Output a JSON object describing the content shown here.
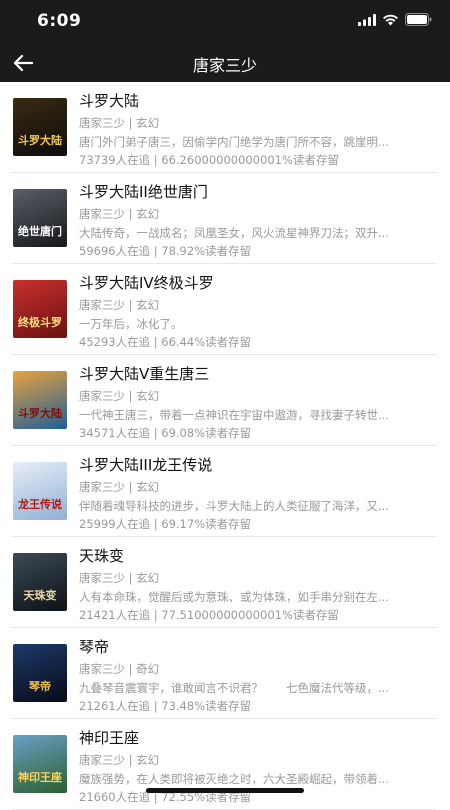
{
  "status": {
    "time": "6:09"
  },
  "header": {
    "title": "唐家三少"
  },
  "colors": {
    "header_bg": "#1b1b1b"
  },
  "books": [
    {
      "title": "斗罗大陆",
      "meta": "唐家三少 | 玄幻",
      "desc": "唐门外门弟子唐三，因偷学内门绝学为唐门所不容，跳崖明...",
      "stats": "73739人在追 | 66.26000000000001%读者存留",
      "cover_text": "斗罗大陆",
      "cover_colors": [
        "#3a2a12",
        "#0d0d0d"
      ],
      "cover_text_color": "#f2c94c"
    },
    {
      "title": "斗罗大陆II绝世唐门",
      "meta": "唐家三少 | 玄幻",
      "desc": "大陆传奇，一战成名；凤凰圣女，风火流星神界刀法；双升...",
      "stats": "59696人在追 | 78.92%读者存留",
      "cover_text": "绝世唐门",
      "cover_colors": [
        "#5b5f66",
        "#16181b"
      ],
      "cover_text_color": "#ffffff"
    },
    {
      "title": "斗罗大陆IV终极斗罗",
      "meta": "唐家三少 | 玄幻",
      "desc": "一万年后，冰化了。",
      "stats": "45293人在追 | 66.44%读者存留",
      "cover_text": "终极斗罗",
      "cover_colors": [
        "#c9302c",
        "#6a1212"
      ],
      "cover_text_color": "#ffe680"
    },
    {
      "title": "斗罗大陆V重生唐三",
      "meta": "唐家三少 | 玄幻",
      "desc": "一代神王唐三，带着一点神识在宇宙中遨游，寻找妻子转世...",
      "stats": "34571人在追 | 69.08%读者存留",
      "cover_text": "斗罗大陆",
      "cover_colors": [
        "#e9a23b",
        "#1f5f9a"
      ],
      "cover_text_color": "#7a1010"
    },
    {
      "title": "斗罗大陆III龙王传说",
      "meta": "唐家三少 | 玄幻",
      "desc": "伴随着魂导科技的进步，斗罗大陆上的人类征服了海洋，又...",
      "stats": "25999人在追 | 69.17%读者存留",
      "cover_text": "龙王传说",
      "cover_colors": [
        "#e8eef6",
        "#8fb0d6"
      ],
      "cover_text_color": "#b01818"
    },
    {
      "title": "天珠变",
      "meta": "唐家三少 | 玄幻",
      "desc": "人有本命珠，觉醒后或为意珠、或为体珠，如手串分别在左...",
      "stats": "21421人在追 | 77.51000000000001%读者存留",
      "cover_text": "天珠变",
      "cover_colors": [
        "#3b4a55",
        "#0e1216"
      ],
      "cover_text_color": "#e8d8a8"
    },
    {
      "title": "琴帝",
      "meta": "唐家三少 | 奇幻",
      "desc": "九叠琴音震寰宇，谁敢闻言不识君？　　七色魔法代等级，...",
      "stats": "21261人在追 | 73.48%读者存留",
      "cover_text": "琴帝",
      "cover_colors": [
        "#1d3a6b",
        "#070b16"
      ],
      "cover_text_color": "#f0c040"
    },
    {
      "title": "神印王座",
      "meta": "唐家三少 | 玄幻",
      "desc": "魔族强势，在人类即将被灭绝之时，六大圣殿崛起，带领着...",
      "stats": "21660人在追 | 72.55%读者存留",
      "cover_text": "神印王座",
      "cover_colors": [
        "#6aa0c8",
        "#2b5f2e"
      ],
      "cover_text_color": "#ffd35a"
    }
  ]
}
